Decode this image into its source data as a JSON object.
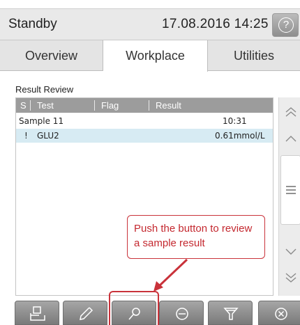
{
  "header": {
    "status": "Standby",
    "datetime": "17.08.2016 14:25",
    "help_label": "?"
  },
  "tabs": [
    {
      "label": "Overview",
      "active": false
    },
    {
      "label": "Workplace",
      "active": true
    },
    {
      "label": "Utilities",
      "active": false
    }
  ],
  "result_review": {
    "title": "Result Review",
    "columns": [
      "S",
      "Test",
      "Flag",
      "Result"
    ],
    "rows": [
      {
        "s": "",
        "test": "Sample 11",
        "flag": "",
        "result": "10:31",
        "selected": false
      },
      {
        "s": "!",
        "test": "GLU2",
        "flag": "",
        "result": "0.61mmol/L",
        "selected": true
      }
    ]
  },
  "scroll": {
    "icons": [
      "double-chevron-up-icon",
      "chevron-up-icon",
      "menu-lines-icon",
      "chevron-down-icon",
      "double-chevron-down-icon"
    ]
  },
  "callout": {
    "text": "Push the button to review a sample result"
  },
  "toolbar": {
    "buttons": [
      "print-icon",
      "pencil-icon",
      "magnifier-icon",
      "minus-circle-icon",
      "filter-icon",
      "close-circle-icon"
    ]
  },
  "colors": {
    "accent_red": "#c9323a",
    "selected_row": "#d7ebf3",
    "table_header": "#9c9c9c",
    "button_gray": "#8e8e8e"
  }
}
